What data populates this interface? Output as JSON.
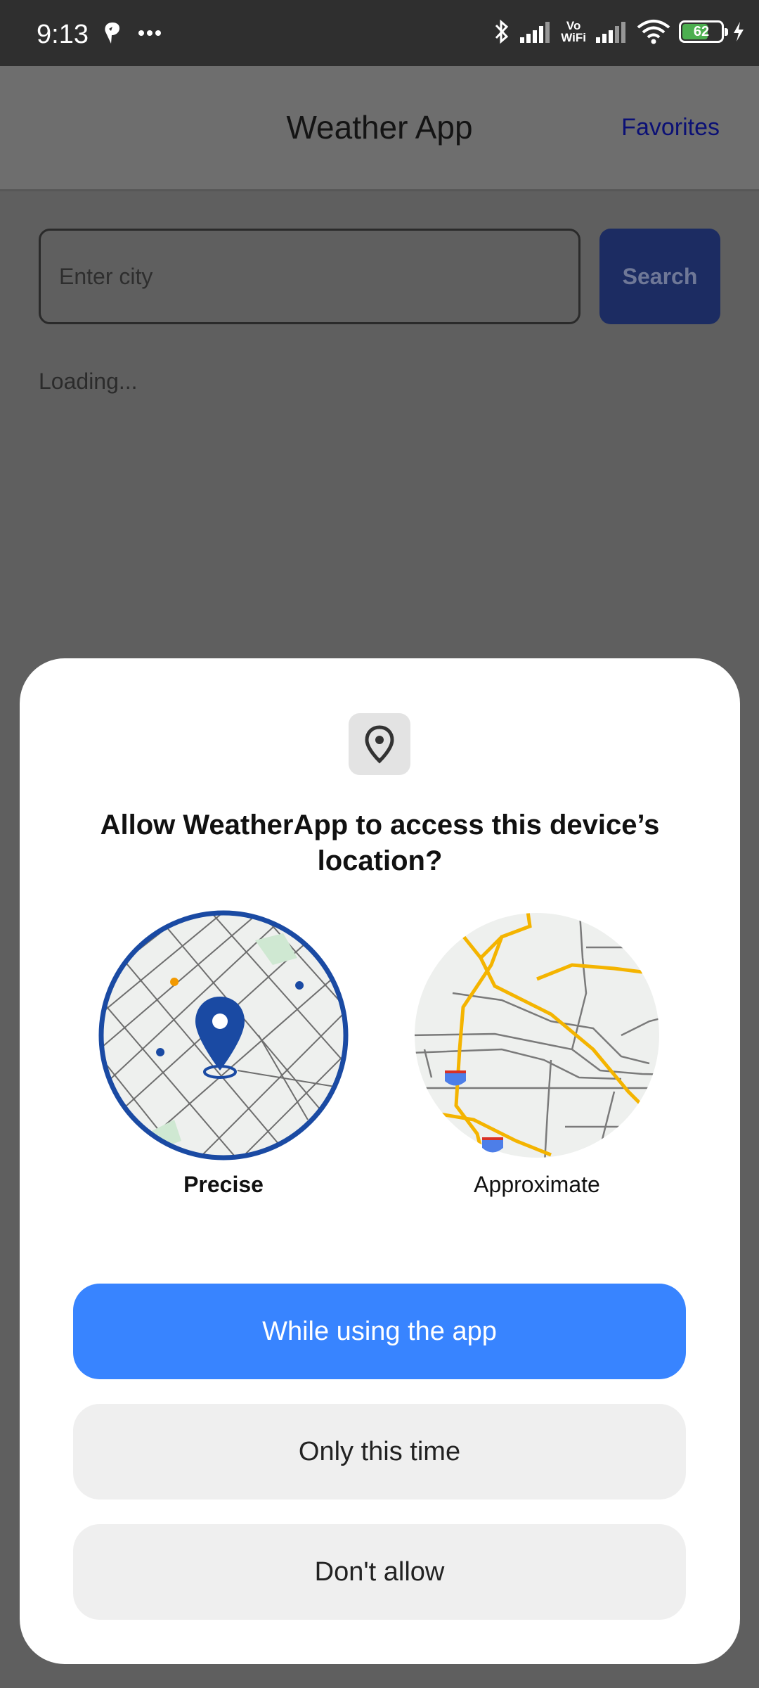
{
  "status_bar": {
    "time": "9:13",
    "battery": "62",
    "vowifi": "Vo\nWiFi",
    "colors": {
      "background": "#2f2f2f",
      "battery": "#4caf50"
    }
  },
  "app": {
    "title": "Weather App",
    "favorites_label": "Favorites",
    "city_placeholder": "Enter city",
    "search_label": "Search",
    "loading_text": "Loading..."
  },
  "permission_dialog": {
    "icon": "location-pin-icon",
    "title": "Allow WeatherApp to access this device’s location?",
    "options": [
      {
        "label": "Precise",
        "selected": true
      },
      {
        "label": "Approximate",
        "selected": false
      }
    ],
    "buttons": {
      "while_using": "While using the app",
      "only_this_time": "Only this time",
      "dont_allow": "Don't allow"
    },
    "colors": {
      "primary": "#3884ff",
      "secondary": "#efefef",
      "precise_ring": "#1a4aa3",
      "road_yellow": "#f4b400"
    }
  }
}
